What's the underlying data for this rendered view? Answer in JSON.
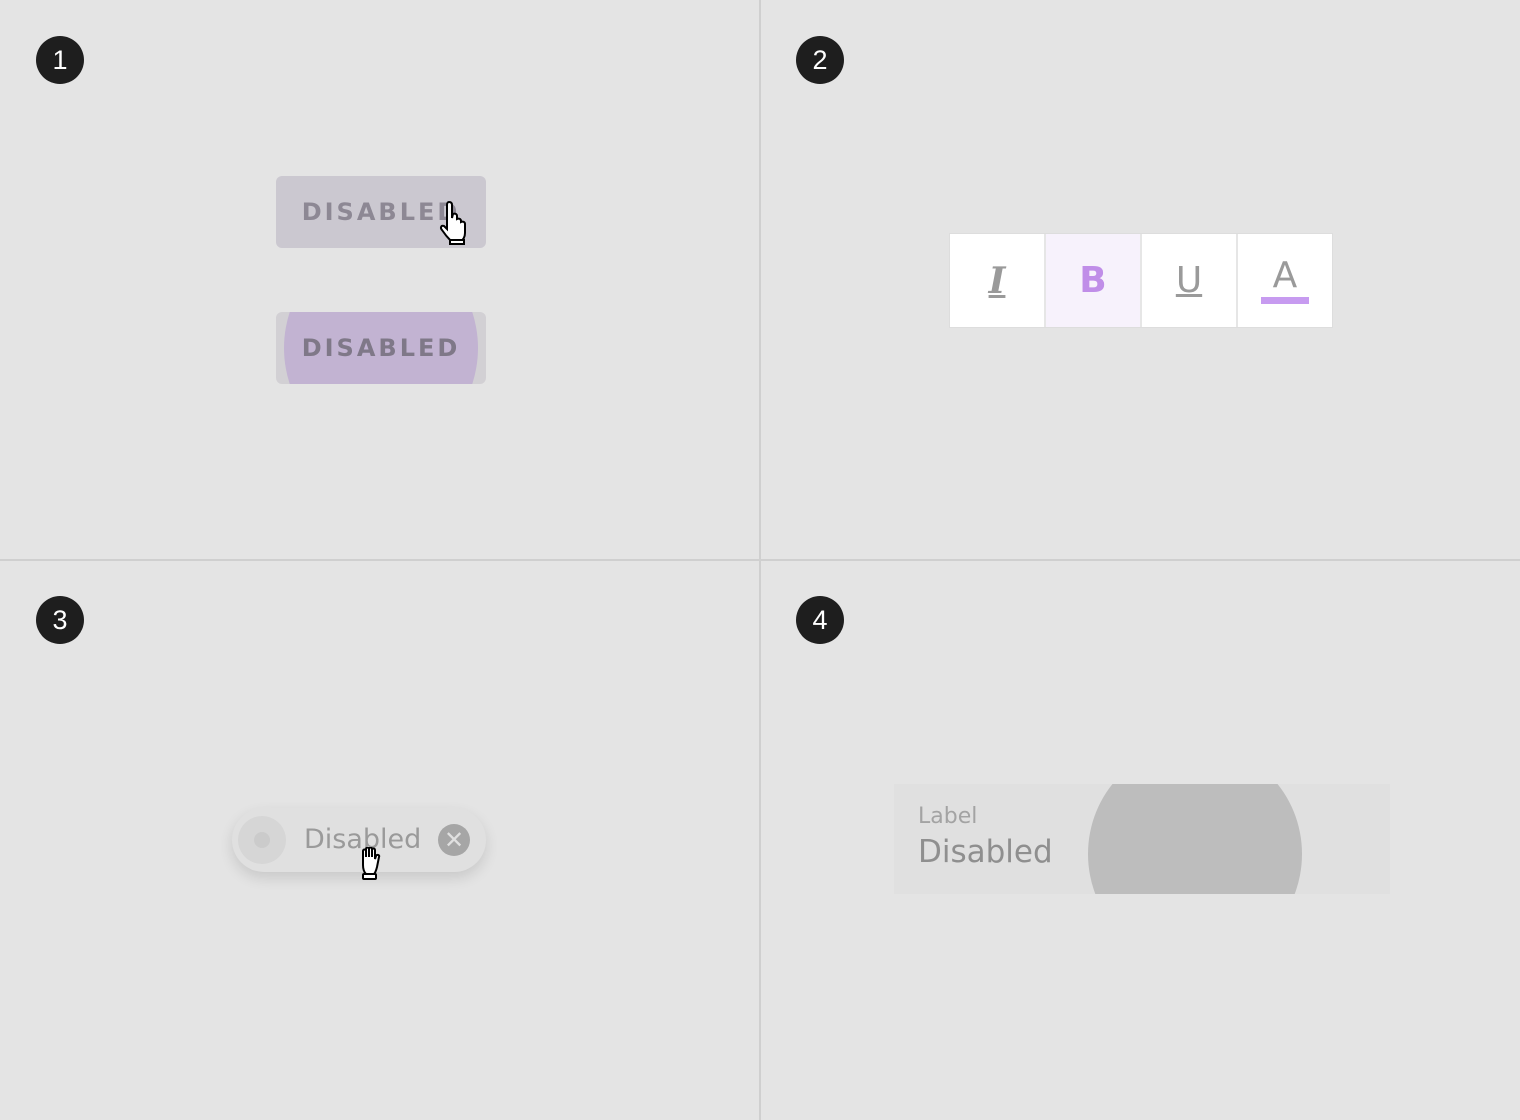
{
  "panels": [
    {
      "number": "1"
    },
    {
      "number": "2"
    },
    {
      "number": "3"
    },
    {
      "number": "4"
    }
  ],
  "panel1": {
    "button_hover_label": "DISABLED",
    "button_pressed_label": "DISABLED",
    "cursor_icon": "pointing-hand-cursor"
  },
  "panel2": {
    "toolbar": [
      {
        "glyph": "I",
        "icon": "format-italic-icon",
        "selected": false
      },
      {
        "glyph": "B",
        "icon": "format-bold-icon",
        "selected": true
      },
      {
        "glyph": "U",
        "icon": "format-underline-icon",
        "selected": false
      },
      {
        "glyph": "A",
        "icon": "text-color-icon",
        "selected": false
      }
    ],
    "accent_color": "#c08ee8"
  },
  "panel3": {
    "chip_label": "Disabled",
    "close_glyph": "✕",
    "cursor_icon": "grab-hand-cursor"
  },
  "panel4": {
    "field_label": "Label",
    "field_value": "Disabled"
  }
}
